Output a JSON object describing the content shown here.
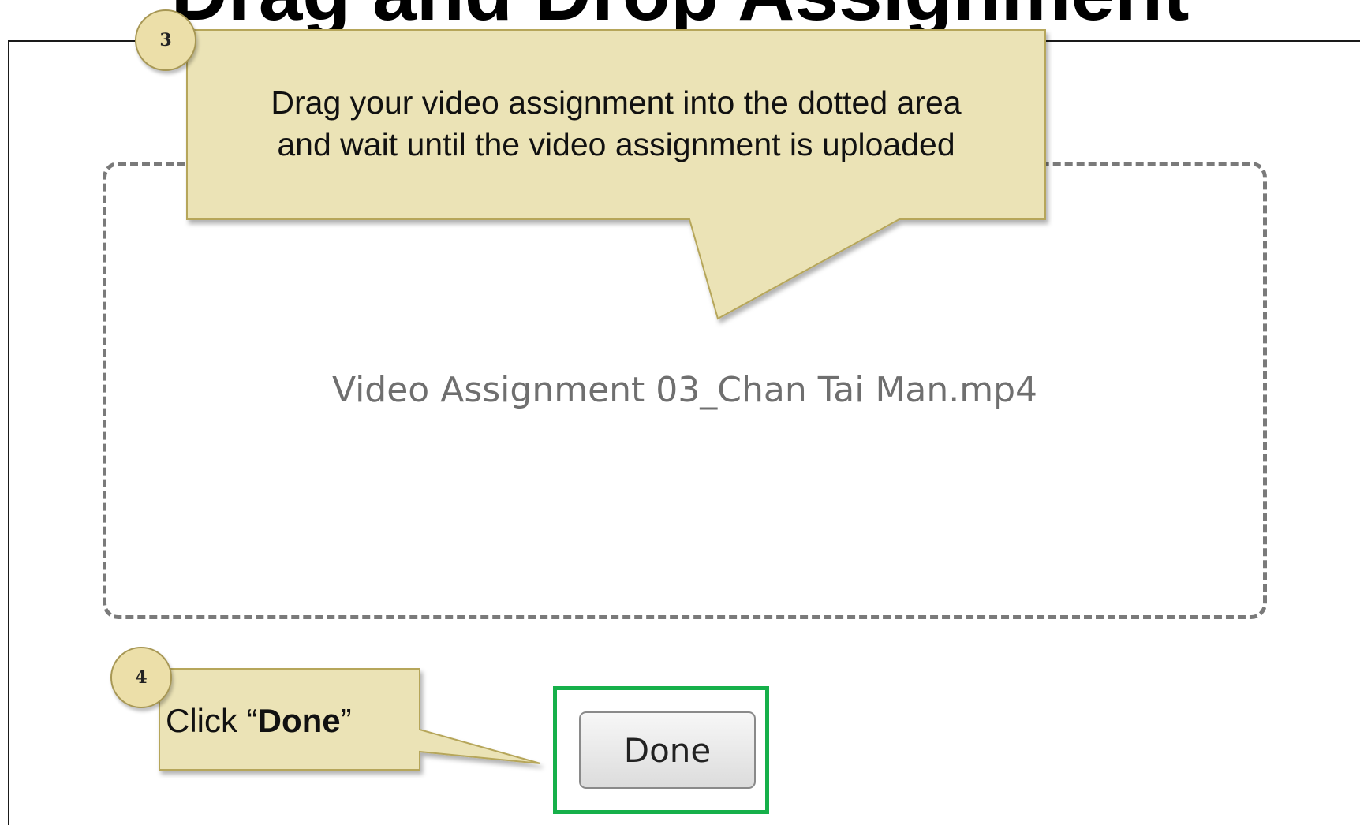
{
  "page": {
    "title_partial": "Drag and Drop Assignment"
  },
  "drop_zone": {
    "file_name": "Video Assignment 03_Chan Tai Man.mp4"
  },
  "actions": {
    "done_label": "Done"
  },
  "annotations": {
    "step3": {
      "number": "3",
      "line1": "Drag your video assignment into the dotted area",
      "line2": "and wait until the video assignment is uploaded"
    },
    "step4": {
      "number": "4",
      "prefix": "Click “",
      "bold": "Done",
      "suffix": "”"
    }
  },
  "colors": {
    "callout_fill": "#ebe3b6",
    "callout_border": "#b6a65a",
    "badge_fill": "#ecdfa9",
    "highlight_border": "#16b04a",
    "drop_zone_border": "#7a7a7a",
    "file_name_text": "#6f6f6f"
  }
}
